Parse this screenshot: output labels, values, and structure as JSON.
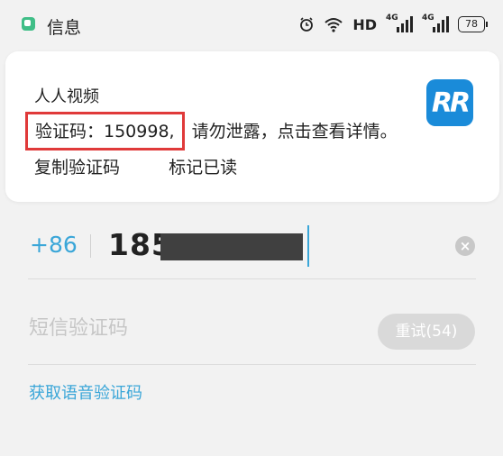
{
  "status_bar": {
    "app_name": "信息",
    "hd": "HD",
    "net_1": "4G",
    "net_2": "4G",
    "battery": "78",
    "accent": "#3fbe87"
  },
  "notification": {
    "sender": "人人视频",
    "code_label": "验证码：150998,",
    "message_rest": "请勿泄露，点击查看详情。",
    "actions": [
      "复制验证码",
      "标记已读"
    ],
    "app_logo_text": "RR",
    "highlight_color": "#e03a3a"
  },
  "phone": {
    "prefix": "+86",
    "number_visible": "185",
    "clear_icon": "×"
  },
  "sms": {
    "placeholder": "短信验证码",
    "retry_label": "重试(54)"
  },
  "voice_link": "获取语音验证码",
  "colors": {
    "accent_blue": "#3aa6d8"
  }
}
